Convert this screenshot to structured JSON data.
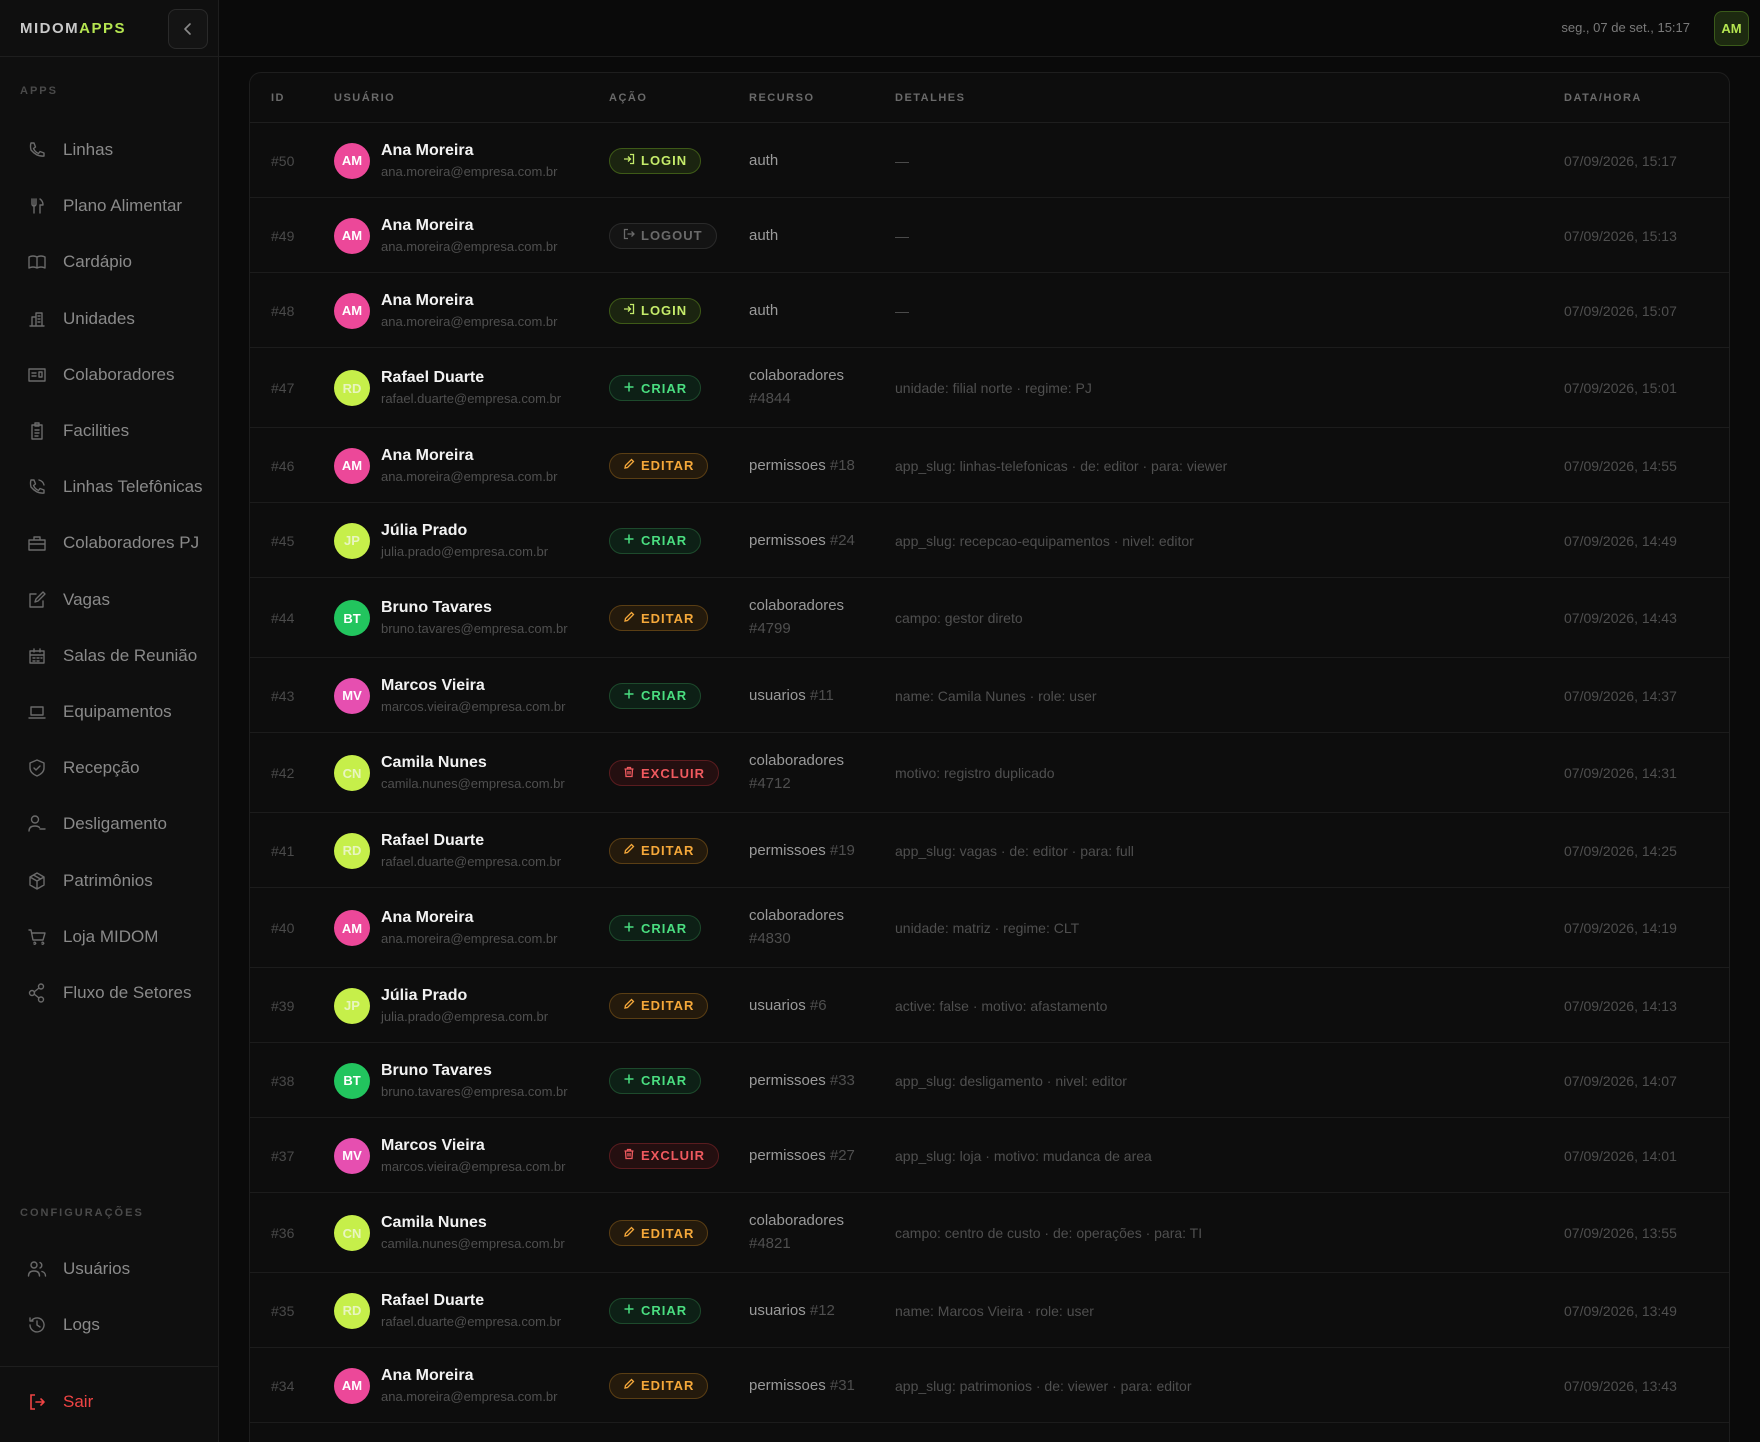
{
  "brand": {
    "part1": "MIDOM",
    "part2": "APPS"
  },
  "sidebar": {
    "section_apps": "APPS",
    "items": [
      {
        "label": "Linhas",
        "icon": "phone-icon"
      },
      {
        "label": "Plano Alimentar",
        "icon": "utensils-icon"
      },
      {
        "label": "Cardápio",
        "icon": "book-open-icon"
      },
      {
        "label": "Unidades",
        "icon": "building-icon"
      },
      {
        "label": "Colaboradores",
        "icon": "id-card-icon"
      },
      {
        "label": "Facilities",
        "icon": "clipboard-icon"
      },
      {
        "label": "Linhas Telefônicas",
        "icon": "phone-call-icon"
      },
      {
        "label": "Colaboradores PJ",
        "icon": "briefcase-icon"
      },
      {
        "label": "Vagas",
        "icon": "edit-icon"
      },
      {
        "label": "Salas de Reunião",
        "icon": "calendar-icon"
      },
      {
        "label": "Equipamentos",
        "icon": "laptop-icon"
      },
      {
        "label": "Recepção",
        "icon": "shield-check-icon"
      },
      {
        "label": "Desligamento",
        "icon": "user-minus-icon"
      },
      {
        "label": "Patrimônios",
        "icon": "package-icon"
      },
      {
        "label": "Loja MIDOM",
        "icon": "cart-icon"
      },
      {
        "label": "Fluxo de Setores",
        "icon": "share-icon"
      }
    ],
    "section_config": "CONFIGURAÇÕES",
    "config_items": [
      {
        "label": "Usuários",
        "icon": "users-icon"
      },
      {
        "label": "Logs",
        "icon": "history-icon"
      }
    ],
    "logout_label": "Sair"
  },
  "topbar": {
    "datetime": "seg., 07 de set., 15:17",
    "avatar": "AM"
  },
  "table": {
    "headers": {
      "id": "ID",
      "user": "USUÁRIO",
      "action": "AÇÃO",
      "resource": "RECURSO",
      "details": "DETALHES",
      "datetime": "DATA/HORA"
    },
    "rows": [
      {
        "id": "#50",
        "initials": "AM",
        "name": "Ana Moreira",
        "email": "ana.moreira@empresa.com.br",
        "action": "LOGIN",
        "resource": "auth",
        "resource_id": "",
        "details": "—",
        "datetime": "07/09/2026, 15:17"
      },
      {
        "id": "#49",
        "initials": "AM",
        "name": "Ana Moreira",
        "email": "ana.moreira@empresa.com.br",
        "action": "LOGOUT",
        "resource": "auth",
        "resource_id": "",
        "details": "—",
        "datetime": "07/09/2026, 15:13"
      },
      {
        "id": "#48",
        "initials": "AM",
        "name": "Ana Moreira",
        "email": "ana.moreira@empresa.com.br",
        "action": "LOGIN",
        "resource": "auth",
        "resource_id": "",
        "details": "—",
        "datetime": "07/09/2026, 15:07"
      },
      {
        "id": "#47",
        "initials": "RD",
        "name": "Rafael Duarte",
        "email": "rafael.duarte@empresa.com.br",
        "action": "CRIAR",
        "resource": "colaboradores",
        "resource_id": "#4844",
        "details": "unidade: filial norte · regime: PJ",
        "datetime": "07/09/2026, 15:01"
      },
      {
        "id": "#46",
        "initials": "AM",
        "name": "Ana Moreira",
        "email": "ana.moreira@empresa.com.br",
        "action": "EDITAR",
        "resource": "permissoes",
        "resource_id": "#18",
        "details": "app_slug: linhas-telefonicas · de: editor · para: viewer",
        "datetime": "07/09/2026, 14:55"
      },
      {
        "id": "#45",
        "initials": "JP",
        "name": "Júlia Prado",
        "email": "julia.prado@empresa.com.br",
        "action": "CRIAR",
        "resource": "permissoes",
        "resource_id": "#24",
        "details": "app_slug: recepcao-equipamentos · nivel: editor",
        "datetime": "07/09/2026, 14:49"
      },
      {
        "id": "#44",
        "initials": "BT",
        "name": "Bruno Tavares",
        "email": "bruno.tavares@empresa.com.br",
        "action": "EDITAR",
        "resource": "colaboradores",
        "resource_id": "#4799",
        "details": "campo: gestor direto",
        "datetime": "07/09/2026, 14:43"
      },
      {
        "id": "#43",
        "initials": "MV",
        "name": "Marcos Vieira",
        "email": "marcos.vieira@empresa.com.br",
        "action": "CRIAR",
        "resource": "usuarios",
        "resource_id": "#11",
        "details": "name: Camila Nunes · role: user",
        "datetime": "07/09/2026, 14:37"
      },
      {
        "id": "#42",
        "initials": "CN",
        "name": "Camila Nunes",
        "email": "camila.nunes@empresa.com.br",
        "action": "EXCLUIR",
        "resource": "colaboradores",
        "resource_id": "#4712",
        "details": "motivo: registro duplicado",
        "datetime": "07/09/2026, 14:31"
      },
      {
        "id": "#41",
        "initials": "RD",
        "name": "Rafael Duarte",
        "email": "rafael.duarte@empresa.com.br",
        "action": "EDITAR",
        "resource": "permissoes",
        "resource_id": "#19",
        "details": "app_slug: vagas · de: editor · para: full",
        "datetime": "07/09/2026, 14:25"
      },
      {
        "id": "#40",
        "initials": "AM",
        "name": "Ana Moreira",
        "email": "ana.moreira@empresa.com.br",
        "action": "CRIAR",
        "resource": "colaboradores",
        "resource_id": "#4830",
        "details": "unidade: matriz · regime: CLT",
        "datetime": "07/09/2026, 14:19"
      },
      {
        "id": "#39",
        "initials": "JP",
        "name": "Júlia Prado",
        "email": "julia.prado@empresa.com.br",
        "action": "EDITAR",
        "resource": "usuarios",
        "resource_id": "#6",
        "details": "active: false · motivo: afastamento",
        "datetime": "07/09/2026, 14:13"
      },
      {
        "id": "#38",
        "initials": "BT",
        "name": "Bruno Tavares",
        "email": "bruno.tavares@empresa.com.br",
        "action": "CRIAR",
        "resource": "permissoes",
        "resource_id": "#33",
        "details": "app_slug: desligamento · nivel: editor",
        "datetime": "07/09/2026, 14:07"
      },
      {
        "id": "#37",
        "initials": "MV",
        "name": "Marcos Vieira",
        "email": "marcos.vieira@empresa.com.br",
        "action": "EXCLUIR",
        "resource": "permissoes",
        "resource_id": "#27",
        "details": "app_slug: loja · motivo: mudanca de area",
        "datetime": "07/09/2026, 14:01"
      },
      {
        "id": "#36",
        "initials": "CN",
        "name": "Camila Nunes",
        "email": "camila.nunes@empresa.com.br",
        "action": "EDITAR",
        "resource": "colaboradores",
        "resource_id": "#4821",
        "details": "campo: centro de custo · de: operações · para: TI",
        "datetime": "07/09/2026, 13:55"
      },
      {
        "id": "#35",
        "initials": "RD",
        "name": "Rafael Duarte",
        "email": "rafael.duarte@empresa.com.br",
        "action": "CRIAR",
        "resource": "usuarios",
        "resource_id": "#12",
        "details": "name: Marcos Vieira · role: user",
        "datetime": "07/09/2026, 13:49"
      },
      {
        "id": "#34",
        "initials": "AM",
        "name": "Ana Moreira",
        "email": "ana.moreira@empresa.com.br",
        "action": "EDITAR",
        "resource": "permissoes",
        "resource_id": "#31",
        "details": "app_slug: patrimonios · de: viewer · para: editor",
        "datetime": "07/09/2026, 13:43"
      }
    ]
  },
  "colors": {
    "accent": "#b5e550",
    "avatar_AM": "#ec4899",
    "avatar_RD": "#c6ef4a",
    "avatar_JP": "#c6ef4a",
    "avatar_BT": "#22c55e",
    "avatar_MV": "#e64fb0",
    "avatar_CN": "#c6ef4a",
    "danger": "#ef4444"
  }
}
